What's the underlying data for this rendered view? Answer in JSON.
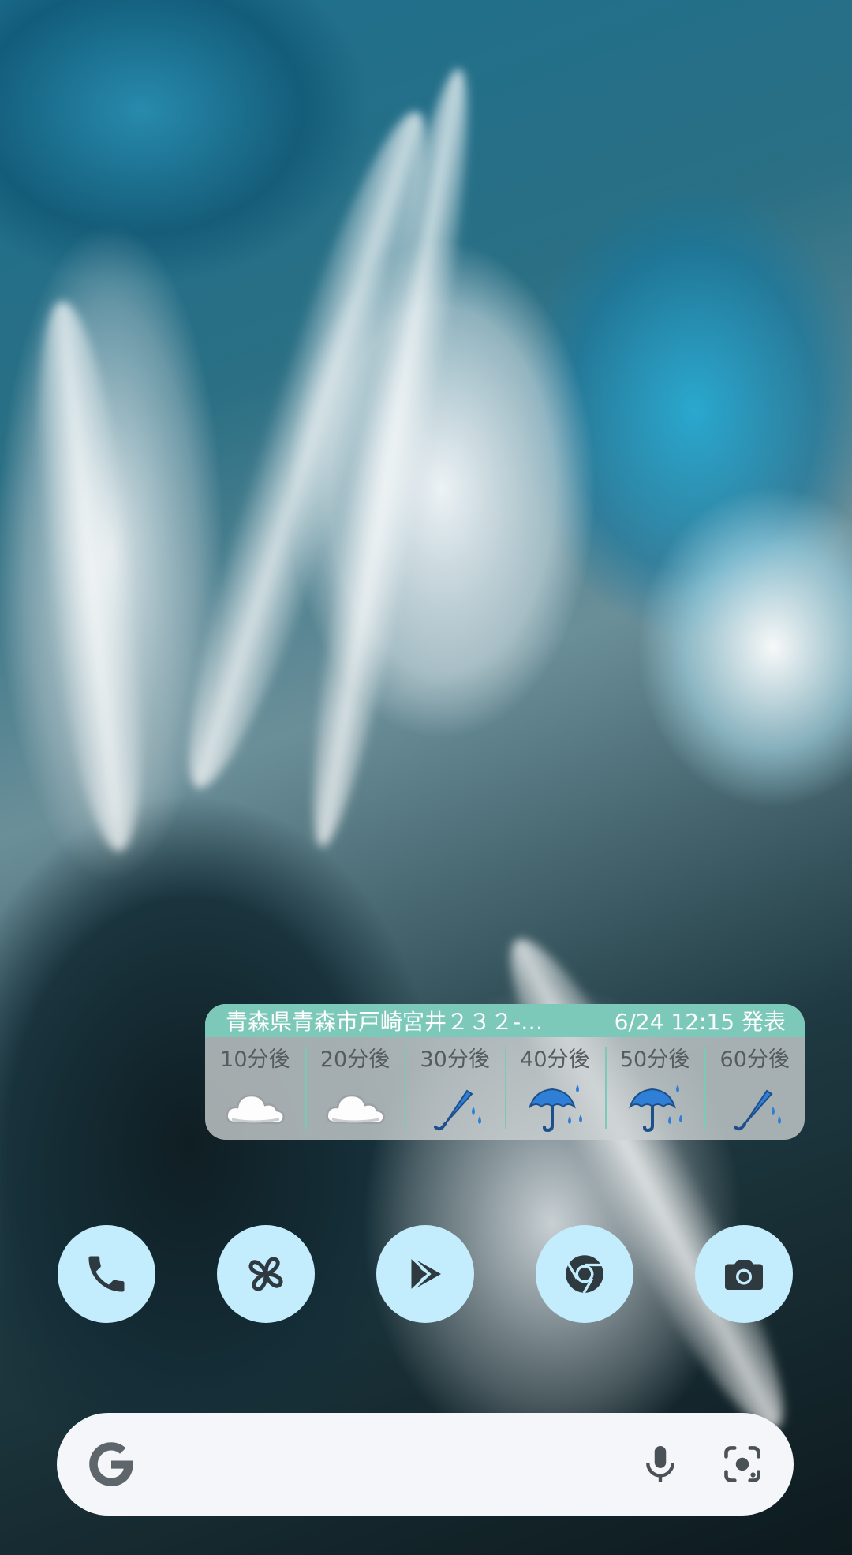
{
  "weather": {
    "location": "青森県青森市戸崎宮井２３２-…",
    "issued": "6/24 12:15 発表",
    "forecast": [
      {
        "label": "10分後",
        "icon": "cloud-icon"
      },
      {
        "label": "20分後",
        "icon": "cloud-icon"
      },
      {
        "label": "30分後",
        "icon": "umbrella-closed-rain-icon"
      },
      {
        "label": "40分後",
        "icon": "umbrella-rain-icon"
      },
      {
        "label": "50分後",
        "icon": "umbrella-rain-icon"
      },
      {
        "label": "60分後",
        "icon": "umbrella-closed-rain-icon"
      }
    ]
  },
  "dock": {
    "apps": [
      {
        "name": "phone",
        "icon": "phone-icon"
      },
      {
        "name": "pinwheel",
        "icon": "pinwheel-icon"
      },
      {
        "name": "play-store",
        "icon": "play-store-icon"
      },
      {
        "name": "chrome",
        "icon": "chrome-icon"
      },
      {
        "name": "camera",
        "icon": "camera-icon"
      }
    ]
  },
  "search": {
    "logo": "google-g-icon",
    "voice": "microphone-icon",
    "lens": "lens-icon"
  },
  "colors": {
    "dock_bg": "#c3ecfd",
    "dock_icon": "#2f3a40",
    "widget_accent": "#7cc8b9",
    "rain_blue": "#2f7fd6",
    "search_bg": "#f4f6fa"
  }
}
